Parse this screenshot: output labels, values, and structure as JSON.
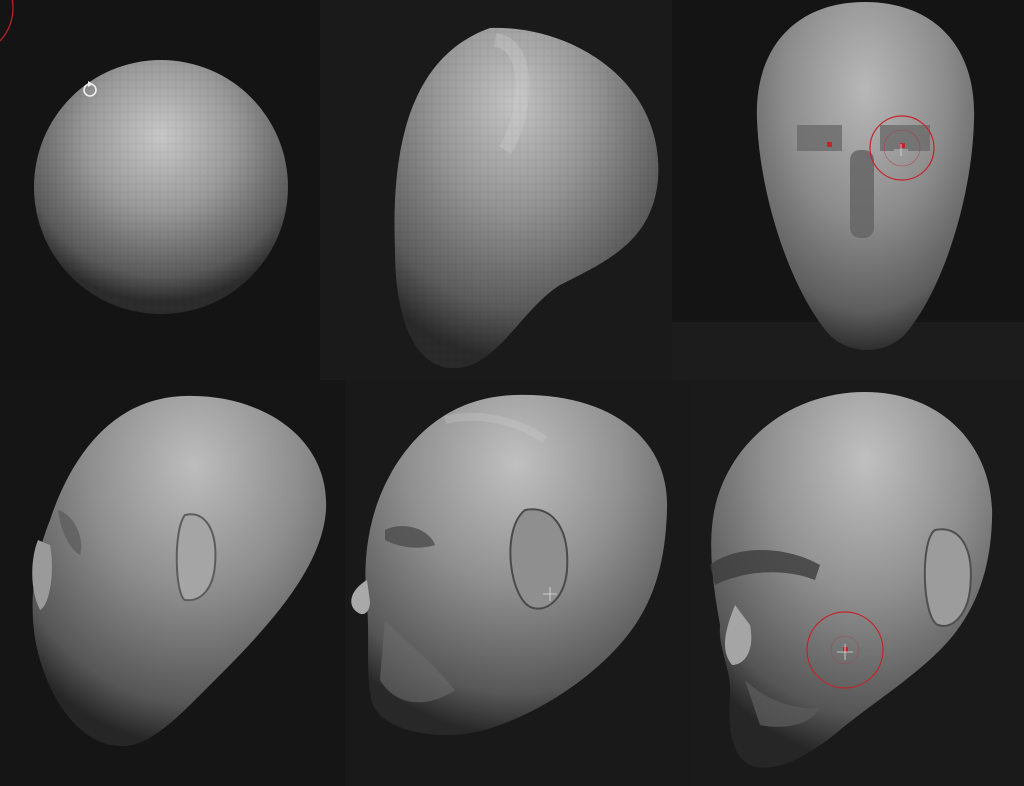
{
  "canvas": {
    "background": "#151516"
  },
  "stages": [
    {
      "id": "sphere",
      "label": ""
    },
    {
      "id": "egg-blockout",
      "label": ""
    },
    {
      "id": "front-eyes",
      "label": ""
    },
    {
      "id": "ear-blockout",
      "label": ""
    },
    {
      "id": "face-forms",
      "label": ""
    },
    {
      "id": "refined-head",
      "label": ""
    }
  ],
  "brush": {
    "cursor_color": "#c4232b",
    "active_tool": "rotate-icon"
  },
  "material": {
    "base": "#8e8e8e",
    "highlight": "#c9c9c9",
    "shadow": "#232323"
  }
}
